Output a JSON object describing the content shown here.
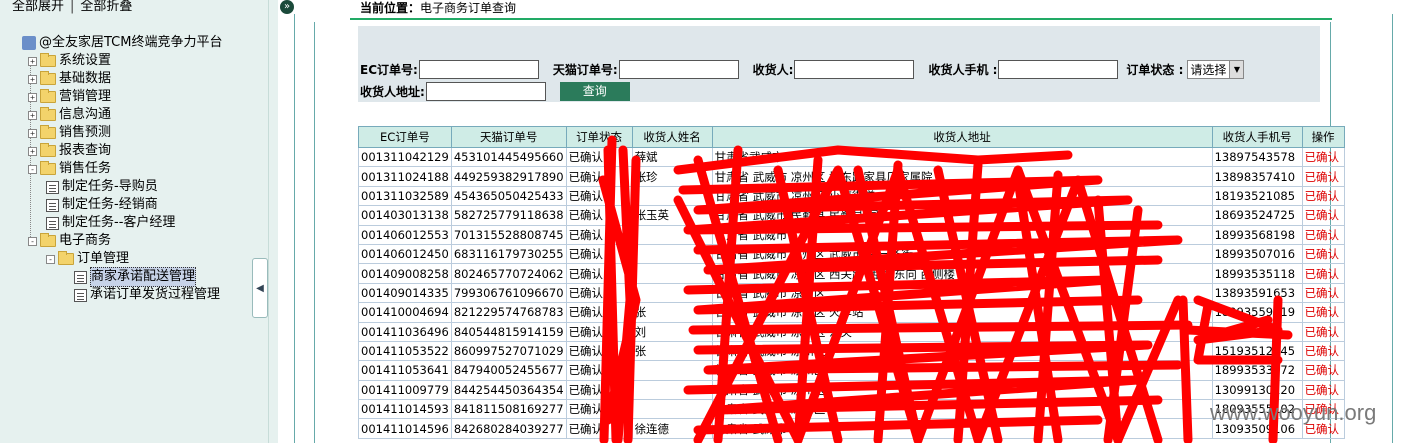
{
  "sidebar": {
    "expand_all": "全部展开",
    "collapse_all": "全部折叠",
    "tree": [
      {
        "label": "@全友家居TCM终端竞争力平台",
        "level": 0,
        "kind": "root"
      },
      {
        "label": "系统设置",
        "level": 1,
        "kind": "folder",
        "pm": "+"
      },
      {
        "label": "基础数据",
        "level": 1,
        "kind": "folder",
        "pm": "+"
      },
      {
        "label": "营销管理",
        "level": 1,
        "kind": "folder",
        "pm": "+"
      },
      {
        "label": "信息沟通",
        "level": 1,
        "kind": "folder",
        "pm": "+"
      },
      {
        "label": "销售预测",
        "level": 1,
        "kind": "folder",
        "pm": "+"
      },
      {
        "label": "报表查询",
        "level": 1,
        "kind": "folder",
        "pm": "+"
      },
      {
        "label": "销售任务",
        "level": 1,
        "kind": "folder",
        "pm": "-"
      },
      {
        "label": "制定任务-导购员",
        "level": 2,
        "kind": "doc"
      },
      {
        "label": "制定任务-经销商",
        "level": 2,
        "kind": "doc"
      },
      {
        "label": "制定任务--客户经理",
        "level": 2,
        "kind": "doc"
      },
      {
        "label": "电子商务",
        "level": 1,
        "kind": "folder",
        "pm": "-"
      },
      {
        "label": "订单管理",
        "level": 2,
        "kind": "folder",
        "pm": "-"
      },
      {
        "label": "商家承诺配送管理",
        "level": 3,
        "kind": "doc",
        "selected": true
      },
      {
        "label": "承诺订单发货过程管理",
        "level": 3,
        "kind": "doc"
      }
    ]
  },
  "location": {
    "prefix": "当前位置：",
    "path": "电子商务订单查询"
  },
  "search": {
    "ec_label": "EC订单号:",
    "tmall_label": "天猫订单号:",
    "receiver_label": "收货人:",
    "phone_label": "收货人手机 :",
    "status_label": "订单状态 :",
    "status_value": "请选择",
    "address_label": "收货人地址:",
    "query_button": "查询"
  },
  "table": {
    "headers": [
      "EC订单号",
      "天猫订单号",
      "订单状态",
      "收货人姓名",
      "收货人地址",
      "收货人手机号",
      "操作"
    ],
    "rows": [
      [
        "001311042129",
        "453101445495660",
        "已确认",
        "薛斌",
        "甘肃省武威市",
        "13897543578",
        "已确认"
      ],
      [
        "001311024188",
        "449259382917890",
        "已确认",
        "张珍",
        "甘肃省 武威市 凉州区 城东路家具厂家属院",
        "13898357410",
        "已确认"
      ],
      [
        "001311032589",
        "454365050425433",
        "已确认",
        "",
        "甘肃省 武威市 凉州区 小南街道",
        "18193521085",
        "已确认"
      ],
      [
        "001403013138",
        "582725779118638",
        "已确认",
        "张玉英",
        "甘肃省 武威市 民勤县 民勤县 同",
        "18693524725",
        "已确认"
      ],
      [
        "001406012553",
        "701315528808745",
        "已确认",
        "",
        "甘肃省 武威市",
        "18993568198",
        "已确认"
      ],
      [
        "001406012450",
        "683116179730255",
        "已确认",
        "",
        "甘肃省 武威市 凉州区 武威市 古一条街",
        "18993507016",
        "已确认"
      ],
      [
        "001409008258",
        "802465770724062",
        "已确认",
        "",
        "甘肃省 武威市 凉州区 西关路 西 街东向 西侧楼",
        "18993535118",
        "已确认"
      ],
      [
        "001409014335",
        "799306761096670",
        "已确认",
        "",
        "甘肃省 武威市 凉州区",
        "13893591653",
        "已确认"
      ],
      [
        "001410004694",
        "821229574768783",
        "已确认",
        "张",
        "甘肃省 武威市 凉州区 火车站",
        "18993559819",
        "已确认"
      ],
      [
        "001411036496",
        "840544815914159",
        "已确认",
        "刘",
        "甘肃省 武威市 凉州区 东关",
        "",
        "已确认"
      ],
      [
        "001411053522",
        "860997527071029",
        "已确认",
        "张",
        "甘肃省 武威市 凉州区",
        "15193512945",
        "已确认"
      ],
      [
        "001411053641",
        "847940052455677",
        "已确认",
        "",
        "甘肃省 武威市 凉州区",
        "18993533072",
        "已确认"
      ],
      [
        "001411009779",
        "844254450364354",
        "已确认",
        "",
        "甘肃省 武威市 凉州区",
        "13099130120",
        "已确认"
      ],
      [
        "001411014593",
        "841811508169277",
        "已确认",
        "",
        "甘肃省 武威市 凉州区",
        "18093555102",
        "已确认"
      ],
      [
        "001411014596",
        "842680284039277",
        "已确认",
        "徐连德",
        "甘肃省 武威市",
        "13093509106",
        "已确认"
      ]
    ]
  },
  "watermark": "www.wooyun.org",
  "colors": {
    "scribble": "#ff0000",
    "header_bg": "#cfece6",
    "sidebar_bg": "#e6f1ef",
    "op_text": "#dd0000"
  }
}
